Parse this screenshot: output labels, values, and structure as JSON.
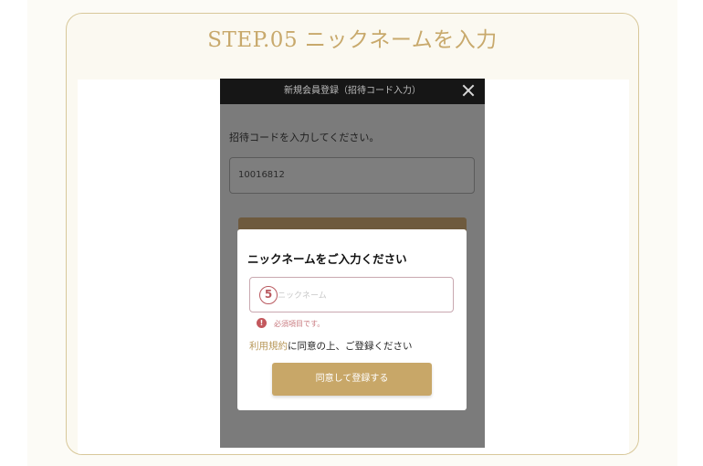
{
  "card": {
    "title": "STEP.05 ニックネームを入力"
  },
  "phone": {
    "header_title": "新規会員登録（招待コード入力）",
    "close_icon": "close-icon",
    "invite_label": "招待コードを入力してください。",
    "invite_code": "10016812"
  },
  "modal": {
    "title": "ニックネームをご入力ください",
    "step_number": "5",
    "nickname_placeholder": "ニックネーム",
    "error_icon_glyph": "!",
    "error_text": "必須項目です。",
    "terms_link": "利用規約",
    "agree_text": "に同意の上、ご登録ください",
    "submit_label": "同意して登録する"
  },
  "colors": {
    "accent_gold": "#c8a768",
    "title_gold": "#c8a96c",
    "error_red": "#c3585d",
    "header_black": "#161616"
  }
}
